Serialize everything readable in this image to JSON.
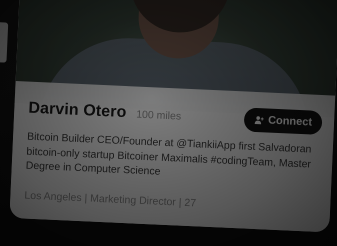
{
  "profile": {
    "name": "Darvin Otero",
    "distance": "100 miles",
    "bio": "Bitcoin Builder CEO/Founder at @TiankiiApp first Salvadoran bitcoin-only startup Bitcoiner Maximalis #codingTeam, Master Degree in Computer Science",
    "meta": "Los Angeles | Marketing Director | 27"
  },
  "actions": {
    "connect_label": "Connect",
    "connect_icon": "add-user-icon"
  },
  "colors": {
    "background": "#111111",
    "card": "#f5f5f5",
    "button": "#151515",
    "button_text": "#ffffff"
  }
}
